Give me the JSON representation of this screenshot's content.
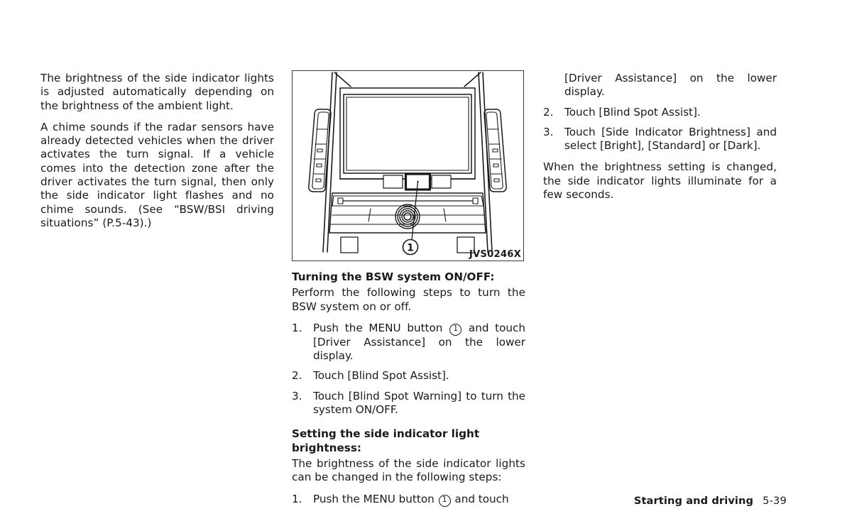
{
  "document": {
    "type": "vehicle-owners-manual-page",
    "footer": {
      "section": "Starting and driving",
      "page_number": "5-39"
    }
  },
  "left_column": {
    "paragraphs": [
      "The brightness of the side indicator lights is adjusted automatically depending on the brightness of the ambient light.",
      "A chime sounds if the radar sensors have already detected vehicles when the driver activates the turn signal. If a vehicle comes into the detection zone after the driver activates the turn signal, then only the side indicator light flashes and no chime sounds. (See “BSW/BSI driving situations” (P.5-43).)"
    ]
  },
  "figure": {
    "caption": "JVS0246X",
    "callout_label": "1",
    "alt": "Illustration of vehicle center console showing upper display screen, left and right side button panels, MENU button highlighted with callout 1, CD slot and control knob"
  },
  "middle_column": {
    "section1": {
      "heading": "Turning the BSW system ON/OFF:",
      "intro": "Perform the following steps to turn the BSW system on or off.",
      "steps": [
        {
          "num": "1.",
          "text_before": "Push the MENU button",
          "circled": "1",
          "text_after": "and touch [Driver Assistance] on the lower display."
        },
        {
          "num": "2.",
          "text": "Touch [Blind Spot Assist]."
        },
        {
          "num": "3.",
          "text": "Touch [Blind Spot Warning] to turn the system ON/OFF."
        }
      ]
    },
    "section2": {
      "heading": "Setting the side indicator light brightness:",
      "intro": "The brightness of the side indicator lights can be changed in the following steps:",
      "steps": [
        {
          "num": "1.",
          "text_before": "Push the MENU button",
          "circled": "1",
          "text_after": "and touch"
        }
      ]
    }
  },
  "right_column": {
    "steps": [
      {
        "num": "",
        "text": "[Driver Assistance] on the lower display."
      },
      {
        "num": "2.",
        "text": "Touch [Blind Spot Assist]."
      },
      {
        "num": "3.",
        "text": "Touch [Side Indicator Brightness] and select [Bright], [Standard] or [Dark]."
      }
    ],
    "closing_paragraph": "When the brightness setting is changed, the side indicator lights illuminate for a few seconds."
  }
}
